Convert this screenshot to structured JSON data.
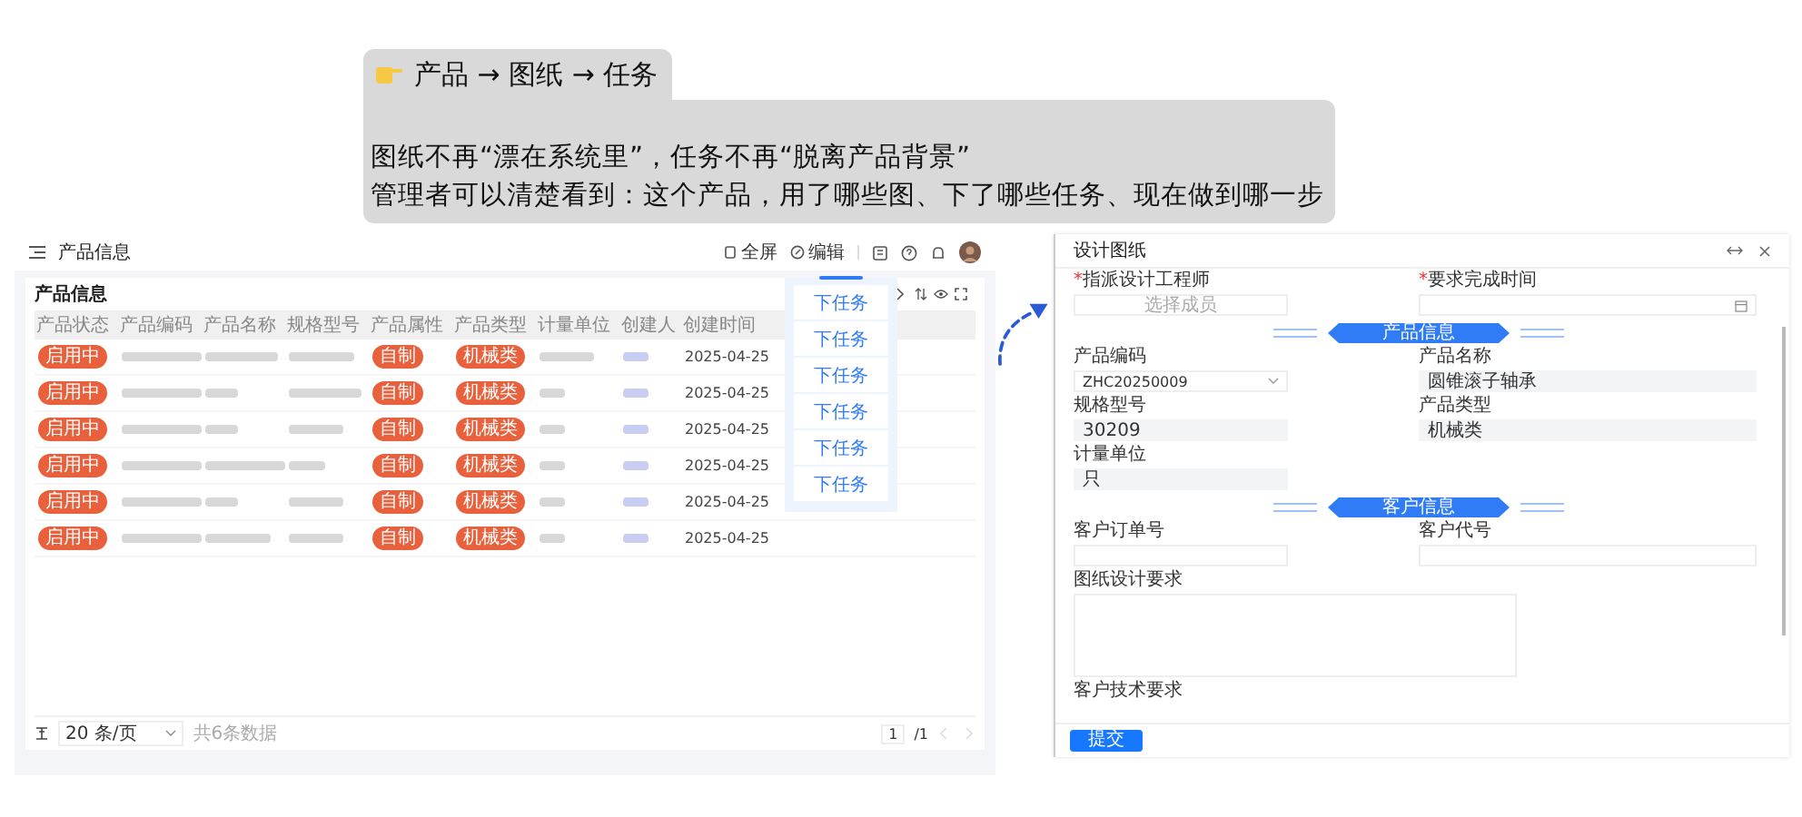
{
  "callout": {
    "title": "产品 → 图纸 → 任务",
    "lines": [
      "图纸不再“漂在系统里”，任务不再“脱离产品背景”",
      "管理者可以清楚看到：这个产品，用了哪些图、下了哪些任务、现在做到哪一步"
    ]
  },
  "product_list": {
    "page_title": "产品信息",
    "toolbar": [
      {
        "kind": "fullscreen",
        "label": "全屏"
      },
      {
        "kind": "edit",
        "label": "编辑"
      }
    ],
    "card_title": "产品信息",
    "columns": [
      "产品状态",
      "产品编码",
      "产品名称",
      "规格型号",
      "产品属性",
      "产品类型",
      "计量单位",
      "创建人",
      "创建时间"
    ],
    "rows": [
      {
        "status": "启用中",
        "attribute": "自制",
        "type": "机械类",
        "created": "2025-04-25"
      },
      {
        "status": "启用中",
        "attribute": "自制",
        "type": "机械类",
        "created": "2025-04-25"
      },
      {
        "status": "启用中",
        "attribute": "自制",
        "type": "机械类",
        "created": "2025-04-25"
      },
      {
        "status": "启用中",
        "attribute": "自制",
        "type": "机械类",
        "created": "2025-04-25"
      },
      {
        "status": "启用中",
        "attribute": "自制",
        "type": "机械类",
        "created": "2025-04-25"
      },
      {
        "status": "启用中",
        "attribute": "自制",
        "type": "机械类",
        "created": "2025-04-25"
      }
    ],
    "footer": {
      "page_size": "20 条/页",
      "total": "共6条数据",
      "page": "1",
      "pages": "/1"
    }
  },
  "task_menu": {
    "items": [
      "下任务",
      "下任务",
      "下任务",
      "下任务",
      "下任务",
      "下任务"
    ]
  },
  "design_form": {
    "title": "设计图纸",
    "fields": [
      {
        "kind": "select",
        "label": "指派设计工程师",
        "required": true,
        "placeholder": "选择成员"
      },
      {
        "kind": "date",
        "label": "要求完成时间",
        "required": true
      },
      {
        "kind": "section",
        "label": "产品信息"
      },
      {
        "kind": "select",
        "label": "产品编码",
        "required": false,
        "value": "ZHC20250009"
      },
      {
        "kind": "readonly",
        "label": "产品名称",
        "required": false,
        "value": "圆锥滚子轴承"
      },
      {
        "kind": "readonly",
        "label": "规格型号",
        "required": false,
        "value": "30209"
      },
      {
        "kind": "readonly",
        "label": "产品类型",
        "required": false,
        "value": "机械类"
      },
      {
        "kind": "readonly",
        "label": "计量单位",
        "required": false,
        "value": "只"
      },
      {
        "kind": "section",
        "label": "客户信息"
      },
      {
        "kind": "text",
        "label": "客户订单号",
        "required": false
      },
      {
        "kind": "text",
        "label": "客户代号",
        "required": false
      },
      {
        "kind": "textarea",
        "label": "图纸设计要求",
        "required": false
      },
      {
        "kind": "label",
        "label": "客户技术要求",
        "required": false
      }
    ],
    "required_mark": "*",
    "submit": "提交"
  }
}
